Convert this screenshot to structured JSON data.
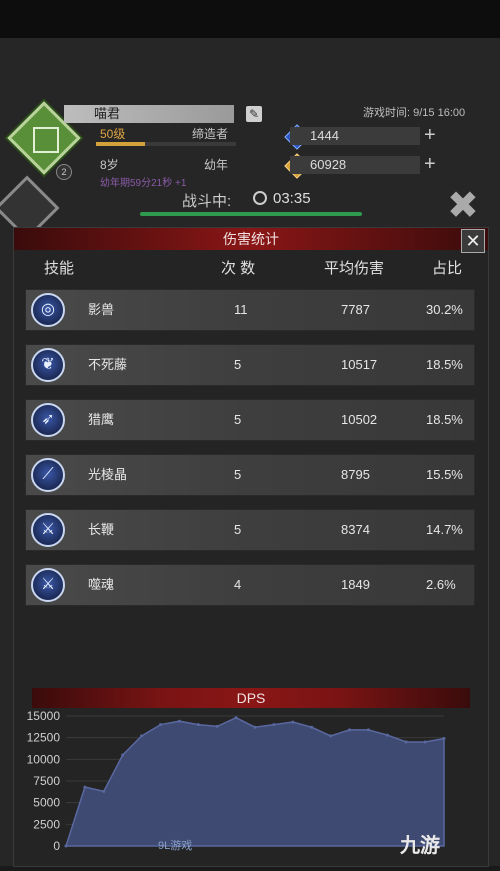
{
  "player": {
    "name": "喵君",
    "level": "50级",
    "title": "缔造者",
    "age": "8岁",
    "age_stage": "幼年",
    "timer_hint": "幼年期59分21秒 +1",
    "level_progress": 0.35,
    "avatar_badge": "2"
  },
  "game_time": "游戏时间: 9/15 16:00",
  "resources": {
    "crystal": "1444",
    "gold": "60928"
  },
  "battle": {
    "label": "战斗中:",
    "time": "03:35"
  },
  "modal": {
    "title": "伤害统计",
    "columns": {
      "skill": "技能",
      "count": "次 数",
      "avg": "平均伤害",
      "ratio": "占比"
    },
    "rows": [
      {
        "name": "影兽",
        "count": "11",
        "avg": "7787",
        "ratio": "30.2%",
        "icon": "beast-swirl-icon"
      },
      {
        "name": "不死藤",
        "count": "5",
        "avg": "10517",
        "ratio": "18.5%",
        "icon": "vine-icon"
      },
      {
        "name": "猎鹰",
        "count": "5",
        "avg": "10502",
        "ratio": "18.5%",
        "icon": "falcon-icon"
      },
      {
        "name": "光棱晶",
        "count": "5",
        "avg": "8795",
        "ratio": "15.5%",
        "icon": "crystal-blade-icon"
      },
      {
        "name": "长鞭",
        "count": "5",
        "avg": "8374",
        "ratio": "14.7%",
        "icon": "whip-icon"
      },
      {
        "name": "噬魂",
        "count": "4",
        "avg": "1849",
        "ratio": "2.6%",
        "icon": "soul-sword-icon"
      }
    ]
  },
  "dps": {
    "title": "DPS"
  },
  "chart_data": {
    "type": "area",
    "title": "DPS",
    "x": [
      0,
      1,
      2,
      3,
      4,
      5,
      6,
      7,
      8,
      9,
      10,
      11,
      12,
      13,
      14,
      15,
      16,
      17,
      18,
      19,
      20
    ],
    "values": [
      0,
      6800,
      6300,
      10500,
      12700,
      14000,
      14400,
      14000,
      13800,
      14800,
      13700,
      14000,
      14300,
      13700,
      12700,
      13400,
      13400,
      12800,
      12000,
      12000,
      12400
    ],
    "ylim": [
      0,
      15000
    ],
    "yticks": [
      "15000",
      "12500",
      "10000",
      "7500",
      "5000",
      "2500",
      "0"
    ],
    "grid": true,
    "fill": "#3e4a72",
    "line": "#5a68a0"
  },
  "watermarks": {
    "game": "9L游戏",
    "brand": "九游"
  },
  "colors": {
    "accent_red": "#8a1616",
    "bar_green": "#2e9a4d",
    "level_orange": "#d4a23a"
  }
}
